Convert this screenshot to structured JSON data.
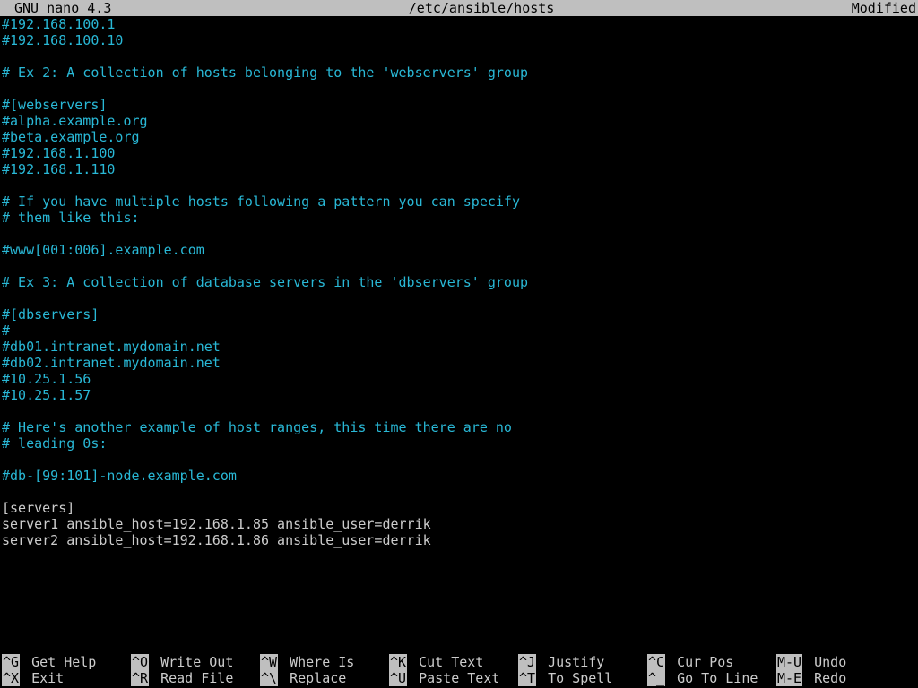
{
  "titlebar": {
    "app": "GNU nano 4.3",
    "file": "/etc/ansible/hosts",
    "status": "Modified"
  },
  "lines": [
    {
      "cls": "comment",
      "text": "#192.168.100.1"
    },
    {
      "cls": "comment",
      "text": "#192.168.100.10"
    },
    {
      "cls": "comment",
      "text": ""
    },
    {
      "cls": "comment",
      "text": "# Ex 2: A collection of hosts belonging to the 'webservers' group"
    },
    {
      "cls": "comment",
      "text": ""
    },
    {
      "cls": "comment",
      "text": "#[webservers]"
    },
    {
      "cls": "comment",
      "text": "#alpha.example.org"
    },
    {
      "cls": "comment",
      "text": "#beta.example.org"
    },
    {
      "cls": "comment",
      "text": "#192.168.1.100"
    },
    {
      "cls": "comment",
      "text": "#192.168.1.110"
    },
    {
      "cls": "comment",
      "text": ""
    },
    {
      "cls": "comment",
      "text": "# If you have multiple hosts following a pattern you can specify"
    },
    {
      "cls": "comment",
      "text": "# them like this:"
    },
    {
      "cls": "comment",
      "text": ""
    },
    {
      "cls": "comment",
      "text": "#www[001:006].example.com"
    },
    {
      "cls": "comment",
      "text": ""
    },
    {
      "cls": "comment",
      "text": "# Ex 3: A collection of database servers in the 'dbservers' group"
    },
    {
      "cls": "comment",
      "text": ""
    },
    {
      "cls": "comment",
      "text": "#[dbservers]"
    },
    {
      "cls": "comment",
      "text": "#"
    },
    {
      "cls": "comment",
      "text": "#db01.intranet.mydomain.net"
    },
    {
      "cls": "comment",
      "text": "#db02.intranet.mydomain.net"
    },
    {
      "cls": "comment",
      "text": "#10.25.1.56"
    },
    {
      "cls": "comment",
      "text": "#10.25.1.57"
    },
    {
      "cls": "comment",
      "text": ""
    },
    {
      "cls": "comment",
      "text": "# Here's another example of host ranges, this time there are no"
    },
    {
      "cls": "comment",
      "text": "# leading 0s:"
    },
    {
      "cls": "comment",
      "text": ""
    },
    {
      "cls": "comment",
      "text": "#db-[99:101]-node.example.com"
    },
    {
      "cls": "plain",
      "text": ""
    },
    {
      "cls": "plain",
      "text": "[servers]"
    },
    {
      "cls": "plain",
      "text": "server1 ansible_host=192.168.1.85 ansible_user=derrik"
    },
    {
      "cls": "plain",
      "text": "server2 ansible_host=192.168.1.86 ansible_user=derrik"
    }
  ],
  "shortcuts": {
    "row1": [
      {
        "key": "^G",
        "label": "Get Help"
      },
      {
        "key": "^O",
        "label": "Write Out"
      },
      {
        "key": "^W",
        "label": "Where Is"
      },
      {
        "key": "^K",
        "label": "Cut Text"
      },
      {
        "key": "^J",
        "label": "Justify"
      },
      {
        "key": "^C",
        "label": "Cur Pos"
      },
      {
        "key": "M-U",
        "label": "Undo"
      }
    ],
    "row2": [
      {
        "key": "^X",
        "label": "Exit"
      },
      {
        "key": "^R",
        "label": "Read File"
      },
      {
        "key": "^\\",
        "label": "Replace"
      },
      {
        "key": "^U",
        "label": "Paste Text"
      },
      {
        "key": "^T",
        "label": "To Spell"
      },
      {
        "key": "^_",
        "label": "Go To Line"
      },
      {
        "key": "M-E",
        "label": "Redo"
      }
    ]
  }
}
